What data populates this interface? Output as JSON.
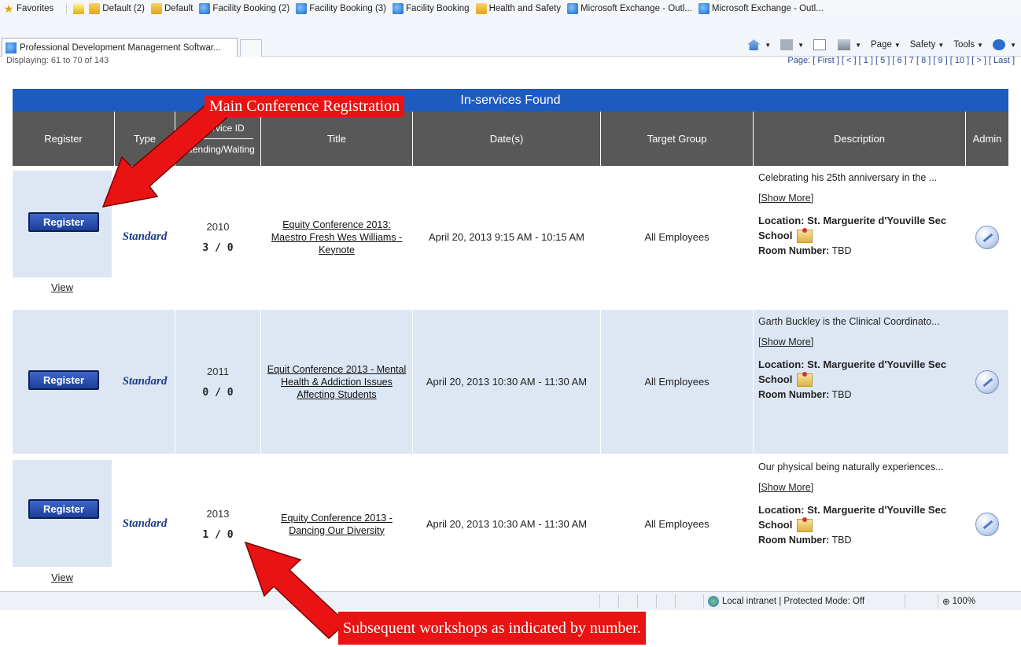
{
  "browser": {
    "favorites_label": "Favorites",
    "favorites": [
      {
        "label": "Default (2)",
        "icon": "folder-icon"
      },
      {
        "label": "Default",
        "icon": "folder-icon"
      },
      {
        "label": "Facility Booking (2)",
        "icon": "ie-icon"
      },
      {
        "label": "Facility Booking (3)",
        "icon": "ie-icon"
      },
      {
        "label": "Facility Booking",
        "icon": "ie-icon"
      },
      {
        "label": "Health and Safety",
        "icon": "folder-icon"
      },
      {
        "label": "Microsoft Exchange - Outl...",
        "icon": "ie-icon"
      },
      {
        "label": "Microsoft Exchange - Outl...",
        "icon": "ie-icon"
      }
    ],
    "tab_title": "Professional Development Management Softwar...",
    "commands": {
      "page": "Page",
      "safety": "Safety",
      "tools": "Tools"
    },
    "status": {
      "zone": "Local intranet | Protected Mode: Off",
      "zoom": "100%"
    }
  },
  "listing": {
    "displaying": "Displaying: 61 to 70 of 143",
    "pager": "Page: [ First ] [ < ] [ 1 ] [ 5 ] [ 6 ] 7 [ 8 ] [ 9 ] [ 10 ] [ > ] [ Last ]",
    "banner": "In-services Found",
    "headers": {
      "register": "Register",
      "type": "Type",
      "id_top": "In-service ID",
      "id_bottom": "Attending/Waiting",
      "title": "Title",
      "dates": "Date(s)",
      "target": "Target Group",
      "description": "Description",
      "admin": "Admin"
    },
    "rows": [
      {
        "register": "Register",
        "view": "View",
        "type": "Standard",
        "id": "2010",
        "counts": "3 / 0",
        "title": "Equity Conference 2013: Maestro Fresh Wes Williams - Keynote",
        "dates": "April 20, 2013  9:15 AM - 10:15 AM",
        "target": "All Employees",
        "teaser": "Celebrating his 25th anniversary in the ...",
        "show_more": "[Show More]",
        "location": "Location: St. Marguerite d'Youville Sec School",
        "room_label": "Room Number:",
        "room_value": "TBD"
      },
      {
        "register": "Register",
        "view": "",
        "type": "Standard",
        "id": "2011",
        "counts": "0 / 0",
        "title": "Equit Conference 2013 - Mental Health & Addiction Issues Affecting Students",
        "dates": "April 20, 2013  10:30 AM - 11:30 AM",
        "target": "All Employees",
        "teaser": "Garth Buckley is the Clinical Coordinato...",
        "show_more": "[Show More]",
        "location": "Location: St. Marguerite d'Youville Sec School",
        "room_label": "Room Number:",
        "room_value": "TBD"
      },
      {
        "register": "Register",
        "view": "View",
        "type": "Standard",
        "id": "2013",
        "counts": "1 / 0",
        "title": "Equity Conference 2013 - Dancing Our Diversity",
        "dates": "April 20, 2013  10:30 AM - 11:30 AM",
        "target": "All Employees",
        "teaser": "Our physical being naturally experiences...",
        "show_more": "[Show More]",
        "location": "Location: St. Marguerite d'Youville Sec School",
        "room_label": "Room Number:",
        "room_value": "TBD"
      }
    ]
  },
  "annotations": {
    "main": "Main Conference Registration",
    "subsequent": "Subsequent workshops as indicated by number.",
    "color": "#e91313"
  }
}
